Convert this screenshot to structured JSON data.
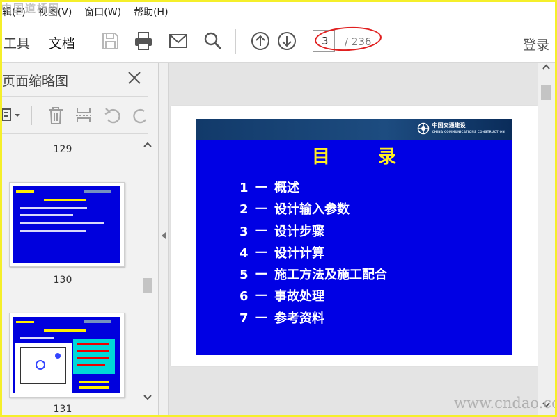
{
  "menubar": {
    "items": [
      {
        "label": "辑(E)"
      },
      {
        "label": "视图(V)"
      },
      {
        "label": "窗口(W)"
      },
      {
        "label": "帮助(H)"
      }
    ],
    "watermark": "中国道桥网"
  },
  "toolbar": {
    "tab_tools": "工具",
    "tab_document": "文档",
    "icons": [
      "save-icon",
      "print-icon",
      "email-icon",
      "search-icon",
      "prev-page-icon",
      "next-page-icon"
    ],
    "current_page": "3",
    "total_pages": "/ 236",
    "login_label": "登录",
    "annotation_color": "#e02020"
  },
  "sidepanel": {
    "title": "页面缩略图",
    "tool_icons": [
      "thumbnail-options-icon",
      "delete-icon",
      "extract-icon",
      "undo-icon",
      "redo-icon"
    ],
    "thumbnails": [
      {
        "label": "129"
      },
      {
        "label": "130"
      },
      {
        "label": "131"
      }
    ]
  },
  "slide": {
    "logo_text": "中国交通建设",
    "logo_subtext": "CHINA COMMUNICATIONS CONSTRUCTION",
    "title": "目 录",
    "toc": [
      {
        "num": "1",
        "dash": "一",
        "text": "概述"
      },
      {
        "num": "2",
        "dash": "一",
        "text": "设计输入参数"
      },
      {
        "num": "3",
        "dash": "一",
        "text": "设计步骤"
      },
      {
        "num": "4",
        "dash": "一",
        "text": "设计计算"
      },
      {
        "num": "5",
        "dash": "一",
        "text": "施工方法及施工配合"
      },
      {
        "num": "6",
        "dash": "一",
        "text": "事故处理"
      },
      {
        "num": "7",
        "dash": "一",
        "text": "参考资料"
      }
    ],
    "colors": {
      "background": "#0000e4",
      "title": "#ffee22",
      "text": "#ffffff"
    }
  },
  "watermark_bottom": "www.cndao.com"
}
